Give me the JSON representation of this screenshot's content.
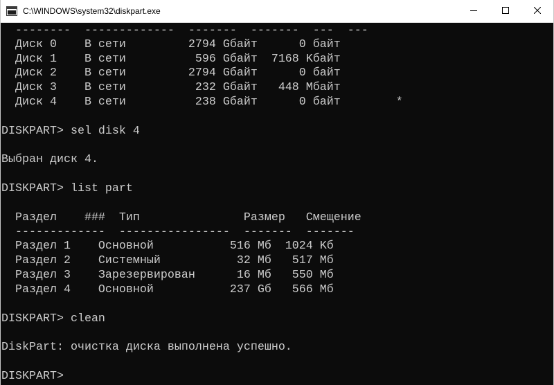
{
  "window": {
    "title": "C:\\WINDOWS\\system32\\diskpart.exe",
    "icon": "console-icon",
    "controls": [
      "minimize-icon",
      "maximize-icon",
      "close-icon"
    ]
  },
  "console": {
    "lines": [
      "  --------  -------------  -------  -------  ---  ---",
      "  Диск 0    В сети         2794 Gбайт      0 байт",
      "  Диск 1    В сети          596 Gбайт  7168 Kбайт",
      "  Диск 2    В сети         2794 Gбайт      0 байт",
      "  Диск 3    В сети          232 Gбайт   448 Mбайт",
      "  Диск 4    В сети          238 Gбайт      0 байт        *",
      "",
      "DISKPART> sel disk 4",
      "",
      "Выбран диск 4.",
      "",
      "DISKPART> list part",
      "",
      "  Раздел    ###  Тип               Размер   Смещение",
      "  -------------  ----------------  -------  -------",
      "  Раздел 1    Основной           516 Mб  1024 Kб",
      "  Раздел 2    Системный           32 Mб   517 Mб",
      "  Раздел 3    Зарезервирован      16 Mб   550 Mб",
      "  Раздел 4    Основной           237 Gб   566 Mб",
      "",
      "DISKPART> clean",
      "",
      "DiskPart: очистка диска выполнена успешно.",
      "",
      "DISKPART>"
    ]
  },
  "colors": {
    "console_background": "#0c0c0c",
    "console_text": "#cccccc",
    "titlebar_background": "#ffffff"
  }
}
